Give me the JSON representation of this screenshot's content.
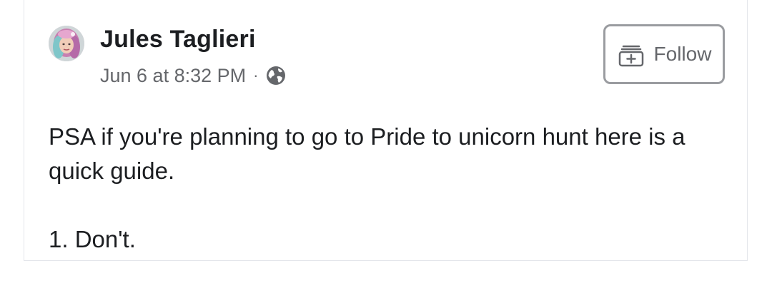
{
  "post": {
    "author": "Jules Taglieri",
    "timestamp": "Jun 6 at 8:32 PM",
    "separator": "·",
    "audience_icon": "globe-icon",
    "follow_label": "Follow",
    "follow_icon": "add-follow-icon",
    "body_line_1": "PSA if you're planning to go to Pride to unicorn hunt here is a quick guide.",
    "body_line_2": "1. Don't."
  },
  "colors": {
    "name": "#1c1e21",
    "meta": "#65676b",
    "border": "#9a9ca0"
  }
}
